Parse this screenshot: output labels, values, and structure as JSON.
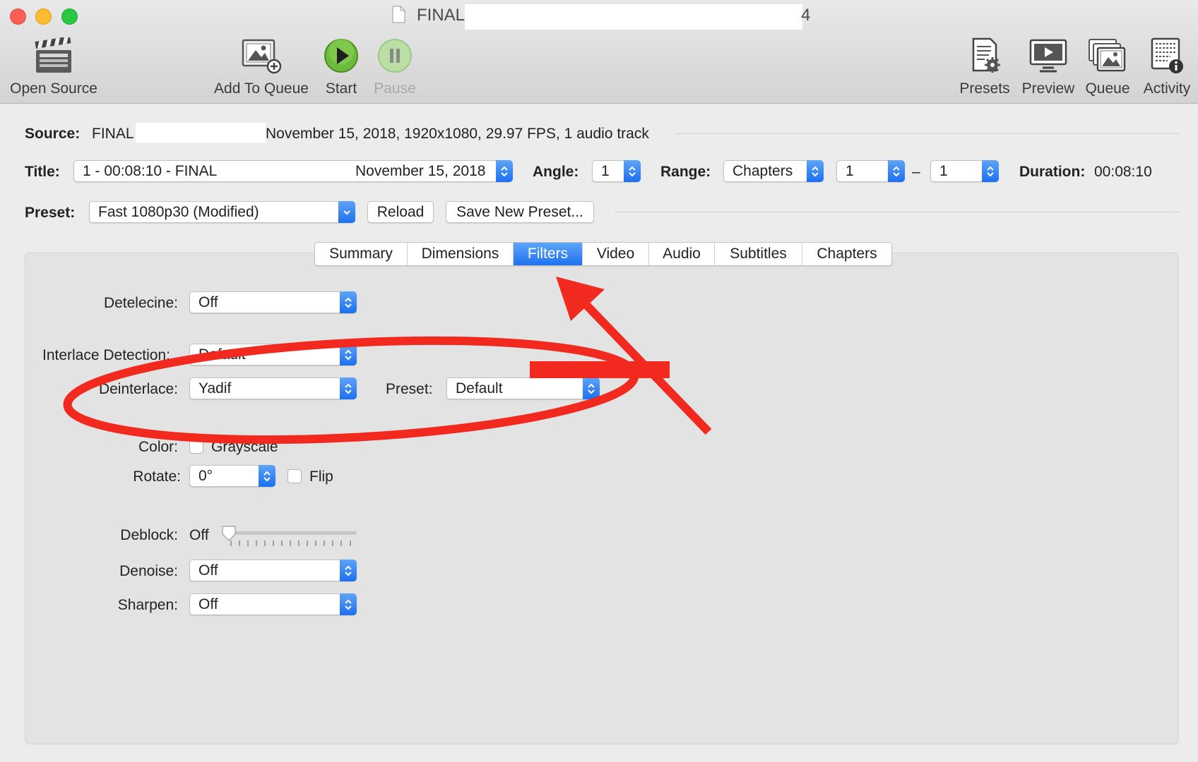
{
  "window": {
    "title": "FINAL",
    "title_tail": "4",
    "traffic_lights": [
      "close",
      "minimize",
      "zoom"
    ]
  },
  "toolbar": {
    "left": [
      {
        "label": "Open Source",
        "icon": "clapperboard-icon"
      },
      {
        "label": "Add To Queue",
        "icon": "add-to-queue-icon"
      },
      {
        "label": "Start",
        "icon": "play-icon"
      },
      {
        "label": "Pause",
        "icon": "pause-icon",
        "disabled": true
      }
    ],
    "right": [
      {
        "label": "Presets",
        "icon": "presets-icon"
      },
      {
        "label": "Preview",
        "icon": "preview-icon"
      },
      {
        "label": "Queue",
        "icon": "queue-icon"
      },
      {
        "label": "Activity",
        "icon": "activity-icon"
      }
    ]
  },
  "source": {
    "label": "Source:",
    "name": "FINAL",
    "details": "November 15, 2018, 1920x1080, 29.97 FPS, 1 audio track"
  },
  "title_row": {
    "title_label": "Title:",
    "title_value": "1 - 00:08:10 - FINAL",
    "title_value_tail": "November 15, 2018",
    "angle_label": "Angle:",
    "angle_value": "1",
    "range_label": "Range:",
    "range_type": "Chapters",
    "range_start": "1",
    "range_dash": "–",
    "range_end": "1",
    "duration_label": "Duration:",
    "duration_value": "00:08:10"
  },
  "preset_row": {
    "label": "Preset:",
    "value": "Fast 1080p30 (Modified)",
    "reload_label": "Reload",
    "save_label": "Save New Preset..."
  },
  "tabs": [
    "Summary",
    "Dimensions",
    "Filters",
    "Video",
    "Audio",
    "Subtitles",
    "Chapters"
  ],
  "active_tab": "Filters",
  "filters": {
    "detelecine_label": "Detelecine:",
    "detelecine_value": "Off",
    "interlace_label": "Interlace Detection:",
    "interlace_value": "Default",
    "deinterlace_label": "Deinterlace:",
    "deinterlace_value": "Yadif",
    "deinterlace_preset_label": "Preset:",
    "deinterlace_preset_value": "Default",
    "color_label": "Color:",
    "grayscale_label": "Grayscale",
    "grayscale_checked": false,
    "rotate_label": "Rotate:",
    "rotate_value": "0°",
    "flip_label": "Flip",
    "flip_checked": false,
    "deblock_label": "Deblock:",
    "deblock_value": "Off",
    "deblock_level": 0,
    "denoise_label": "Denoise:",
    "denoise_value": "Off",
    "sharpen_label": "Sharpen:",
    "sharpen_value": "Off"
  },
  "colors": {
    "accent": "#1f72f0",
    "annotation": "#f1291f"
  }
}
